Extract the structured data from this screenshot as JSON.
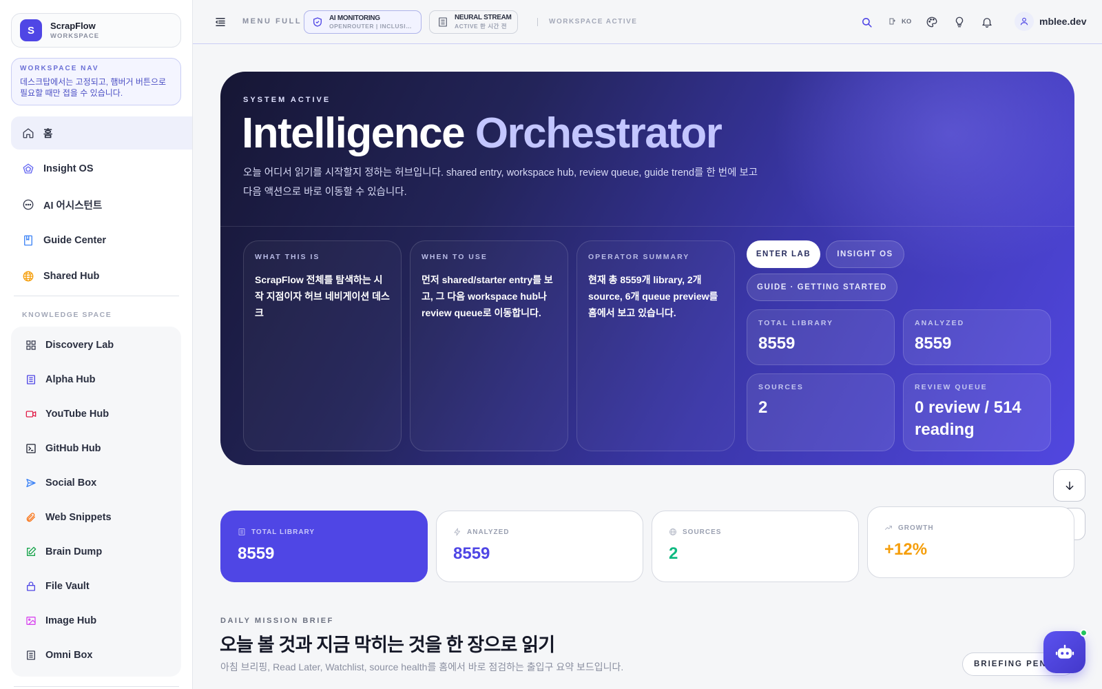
{
  "brand": {
    "name": "ScrapFlow",
    "sub": "WORKSPACE",
    "logo": "S"
  },
  "navnote": {
    "title": "WORKSPACE NAV",
    "text": "데스크탑에서는 고정되고, 햄버거 버튼으로 필요할 때만 접을 수 있습니다."
  },
  "nav": [
    {
      "label": "홈",
      "icon": "home-icon"
    },
    {
      "label": "Insight OS",
      "icon": "pentagon-icon"
    },
    {
      "label": "AI 어시스턴트",
      "icon": "chat-icon"
    },
    {
      "label": "Guide Center",
      "icon": "book-icon"
    },
    {
      "label": "Shared Hub",
      "icon": "globe-icon"
    }
  ],
  "knowledge": {
    "label": "KNOWLEDGE SPACE",
    "items": [
      {
        "label": "Discovery Lab",
        "icon": "grid-icon"
      },
      {
        "label": "Alpha Hub",
        "icon": "document-icon"
      },
      {
        "label": "YouTube Hub",
        "icon": "video-icon"
      },
      {
        "label": "GitHub Hub",
        "icon": "terminal-icon"
      },
      {
        "label": "Social Box",
        "icon": "send-icon"
      },
      {
        "label": "Web Snippets",
        "icon": "paperclip-icon"
      },
      {
        "label": "Brain Dump",
        "icon": "edit-icon"
      },
      {
        "label": "File Vault",
        "icon": "lock-icon"
      },
      {
        "label": "Image Hub",
        "icon": "image-icon"
      },
      {
        "label": "Omni Box",
        "icon": "list-icon"
      }
    ]
  },
  "topbar": {
    "menu_full": "MENU FULL",
    "pill_ai": {
      "title": "AI MONITORING",
      "sub": "OPENROUTER | INCLUSIONAI"
    },
    "pill_ns": {
      "title": "NEURAL STREAM",
      "sub": "ACTIVE 한 시간 전"
    },
    "workspace_active": "WORKSPACE ACTIVE",
    "lang": "KO",
    "username": "mblee.dev"
  },
  "hero": {
    "eyebrow": "SYSTEM ACTIVE",
    "title_a": "Intelligence",
    "title_b": "Orchestrator",
    "desc": "오늘 어디서 읽기를 시작할지 정하는 허브입니다. shared entry, workspace hub, review queue, guide trend를 한 번에 보고 다음 액션으로 바로 이동할 수 있습니다.",
    "cards": [
      {
        "label": "WHAT THIS IS",
        "text": "ScrapFlow 전체를 탐색하는 시작 지점이자 허브 네비게이션 데스크"
      },
      {
        "label": "WHEN TO USE",
        "text": "먼저 shared/starter entry를 보고, 그 다음 workspace hub나 review queue로 이동합니다."
      },
      {
        "label": "OPERATOR SUMMARY",
        "text": "현재 총 8559개 library, 2개 source, 6개 queue preview를 홈에서 보고 있습니다."
      }
    ],
    "btn_enter": "ENTER LAB",
    "btn_insight": "INSIGHT OS",
    "btn_guide": "GUIDE · GETTING STARTED",
    "stats": [
      {
        "label": "TOTAL LIBRARY",
        "value": "8559"
      },
      {
        "label": "ANALYZED",
        "value": "8559"
      },
      {
        "label": "SOURCES",
        "value": "2"
      },
      {
        "label": "REVIEW QUEUE",
        "value": "0 review / 514 reading"
      }
    ]
  },
  "kpis": [
    {
      "label": "TOTAL LIBRARY",
      "value": "8559",
      "icon": "document-icon",
      "color": "#ffffff"
    },
    {
      "label": "ANALYZED",
      "value": "8559",
      "icon": "bolt-icon",
      "color": "#4f46e5"
    },
    {
      "label": "SOURCES",
      "value": "2",
      "icon": "globe-icon",
      "color": "#10b981"
    },
    {
      "label": "GROWTH",
      "value": "+12%",
      "icon": "trend-icon",
      "color": "#f59e0b"
    }
  ],
  "brief": {
    "label": "DAILY MISSION BRIEF",
    "title": "오늘 볼 것과 지금 막히는 것을 한 장으로 읽기",
    "desc": "아침 브리핑, Read Later, Watchlist, source health를 홈에서 바로 점검하는 출입구 요약 보드입니다.",
    "button": "BRIEFING PENDING"
  },
  "colors": {
    "accent": "#4f46e5",
    "success": "#10b981",
    "warning": "#f59e0b",
    "online": "#22c55e"
  }
}
